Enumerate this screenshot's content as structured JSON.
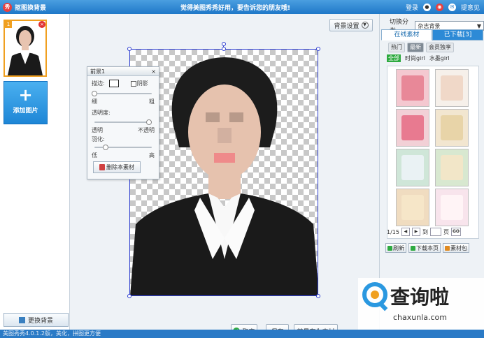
{
  "app": {
    "title": "抠图换背景",
    "banner": "觉得美图秀秀好用，要告诉您的朋友哦!",
    "login": "登录",
    "feedback": "提意见",
    "accent": "#1f78c8"
  },
  "left": {
    "thumb_badge": "1",
    "thumb_close": "×",
    "add_plus": "+",
    "add_label": "添加图片",
    "change_bg": "更换背景"
  },
  "canvas": {
    "bg_settings": "背景设置",
    "foreground": {
      "title": "前景1",
      "close": "×",
      "stroke_label": "描边:",
      "shadow_label": "阴影",
      "thin": "细",
      "thick": "粗",
      "opacity_label": "透明度:",
      "transparent": "透明",
      "opaque": "不透明",
      "feather_label": "羽化:",
      "low": "低",
      "high": "高",
      "delete_button": "删除本素材",
      "stroke_width": 0.0,
      "opacity": 1.0,
      "feather": 0.2
    },
    "actions": {
      "confirm": "确定",
      "save": "保存",
      "save_as_material": "前景存为素材"
    }
  },
  "right": {
    "switch_label": "切换分类",
    "category": "杂志背景",
    "tabs": [
      "在线素材",
      "已下载[3]"
    ],
    "subtabs": [
      "热门",
      "最新",
      "会员独享"
    ],
    "cats": [
      "全部",
      "时尚girl",
      "水墨girl"
    ],
    "tiles": [
      {
        "outer": "#f4c8d0",
        "inner": "#e88898"
      },
      {
        "outer": "#f6f0ea",
        "inner": "#f0d8c8"
      },
      {
        "outer": "#f2d0d6",
        "inner": "#e87a90"
      },
      {
        "outer": "#f2e6d0",
        "inner": "#e8d4a8"
      },
      {
        "outer": "#cfe6d8",
        "inner": "#eaf2f4"
      },
      {
        "outer": "#d8e8d0",
        "inner": "#f2e6c8"
      },
      {
        "outer": "#f0dcc0",
        "inner": "#f6e6c8"
      },
      {
        "outer": "#f8e4ec",
        "inner": "#fff4f6"
      }
    ],
    "pager": {
      "label": "1/15",
      "to": "到",
      "page": "页",
      "go": "GO"
    },
    "refresh": "刷新",
    "download_page": "下载本页",
    "material_pack": "素材包"
  },
  "watermark": {
    "main": "查询啦",
    "sub": "chaxunla.com"
  },
  "status": "美图秀秀4.0.1.2版，美化，拼图更方便"
}
